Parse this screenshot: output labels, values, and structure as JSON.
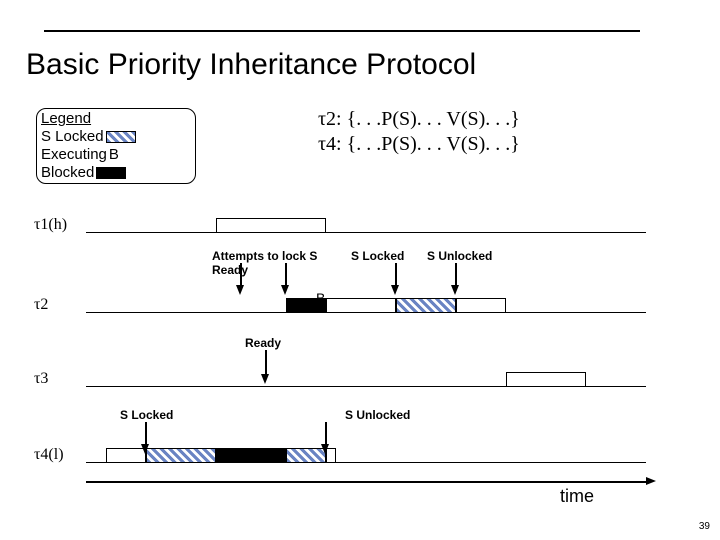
{
  "title": "Basic Priority Inheritance Protocol",
  "legend": {
    "heading": "Legend",
    "sLocked": "S Locked",
    "executing": "Executing",
    "execGlyph": "B",
    "blocked": "Blocked"
  },
  "formulas": {
    "l1": "τ2: {. . .P(S). . . V(S). . .}",
    "l2": "τ4: {. . .P(S). . . V(S). . .}"
  },
  "lanes": {
    "t1": "τ1(h)",
    "t2": "τ2",
    "t3": "τ3",
    "t4": "τ4(l)"
  },
  "notes": {
    "attempts": "Attempts to lock S",
    "ready": "Ready",
    "sLocked": "S Locked",
    "sUnlocked": "S Unlocked",
    "b": "B"
  },
  "axis": {
    "time": "time"
  },
  "page": "39",
  "chart_data": {
    "type": "timeline",
    "title": "Basic Priority Inheritance Protocol",
    "x_range": [
      0,
      560
    ],
    "tasks": [
      {
        "name": "τ1(h)",
        "segments": [
          {
            "start": 130,
            "end": 240,
            "state": "executing"
          }
        ]
      },
      {
        "name": "τ2",
        "segments": [
          {
            "start": 200,
            "end": 240,
            "state": "blocked",
            "note": "Attempts to lock S, B"
          },
          {
            "start": 240,
            "end": 310,
            "state": "executing"
          },
          {
            "start": 310,
            "end": 370,
            "state": "s-locked"
          },
          {
            "start": 370,
            "end": 420,
            "state": "executing"
          }
        ],
        "events": [
          {
            "t": 155,
            "label": "Ready"
          },
          {
            "t": 200,
            "label": "Attempts to lock S"
          },
          {
            "t": 310,
            "label": "S Locked"
          },
          {
            "t": 370,
            "label": "S Unlocked"
          }
        ]
      },
      {
        "name": "τ3",
        "segments": [
          {
            "start": 420,
            "end": 500,
            "state": "executing"
          }
        ],
        "events": [
          {
            "t": 180,
            "label": "Ready"
          }
        ]
      },
      {
        "name": "τ4(l)",
        "segments": [
          {
            "start": 20,
            "end": 60,
            "state": "executing"
          },
          {
            "start": 60,
            "end": 130,
            "state": "s-locked"
          },
          {
            "start": 130,
            "end": 200,
            "state": "blocked"
          },
          {
            "start": 200,
            "end": 240,
            "state": "s-locked"
          },
          {
            "start": 240,
            "end": 250,
            "state": "executing"
          }
        ],
        "events": [
          {
            "t": 60,
            "label": "S Locked"
          },
          {
            "t": 240,
            "label": "S Unlocked"
          }
        ]
      }
    ]
  }
}
